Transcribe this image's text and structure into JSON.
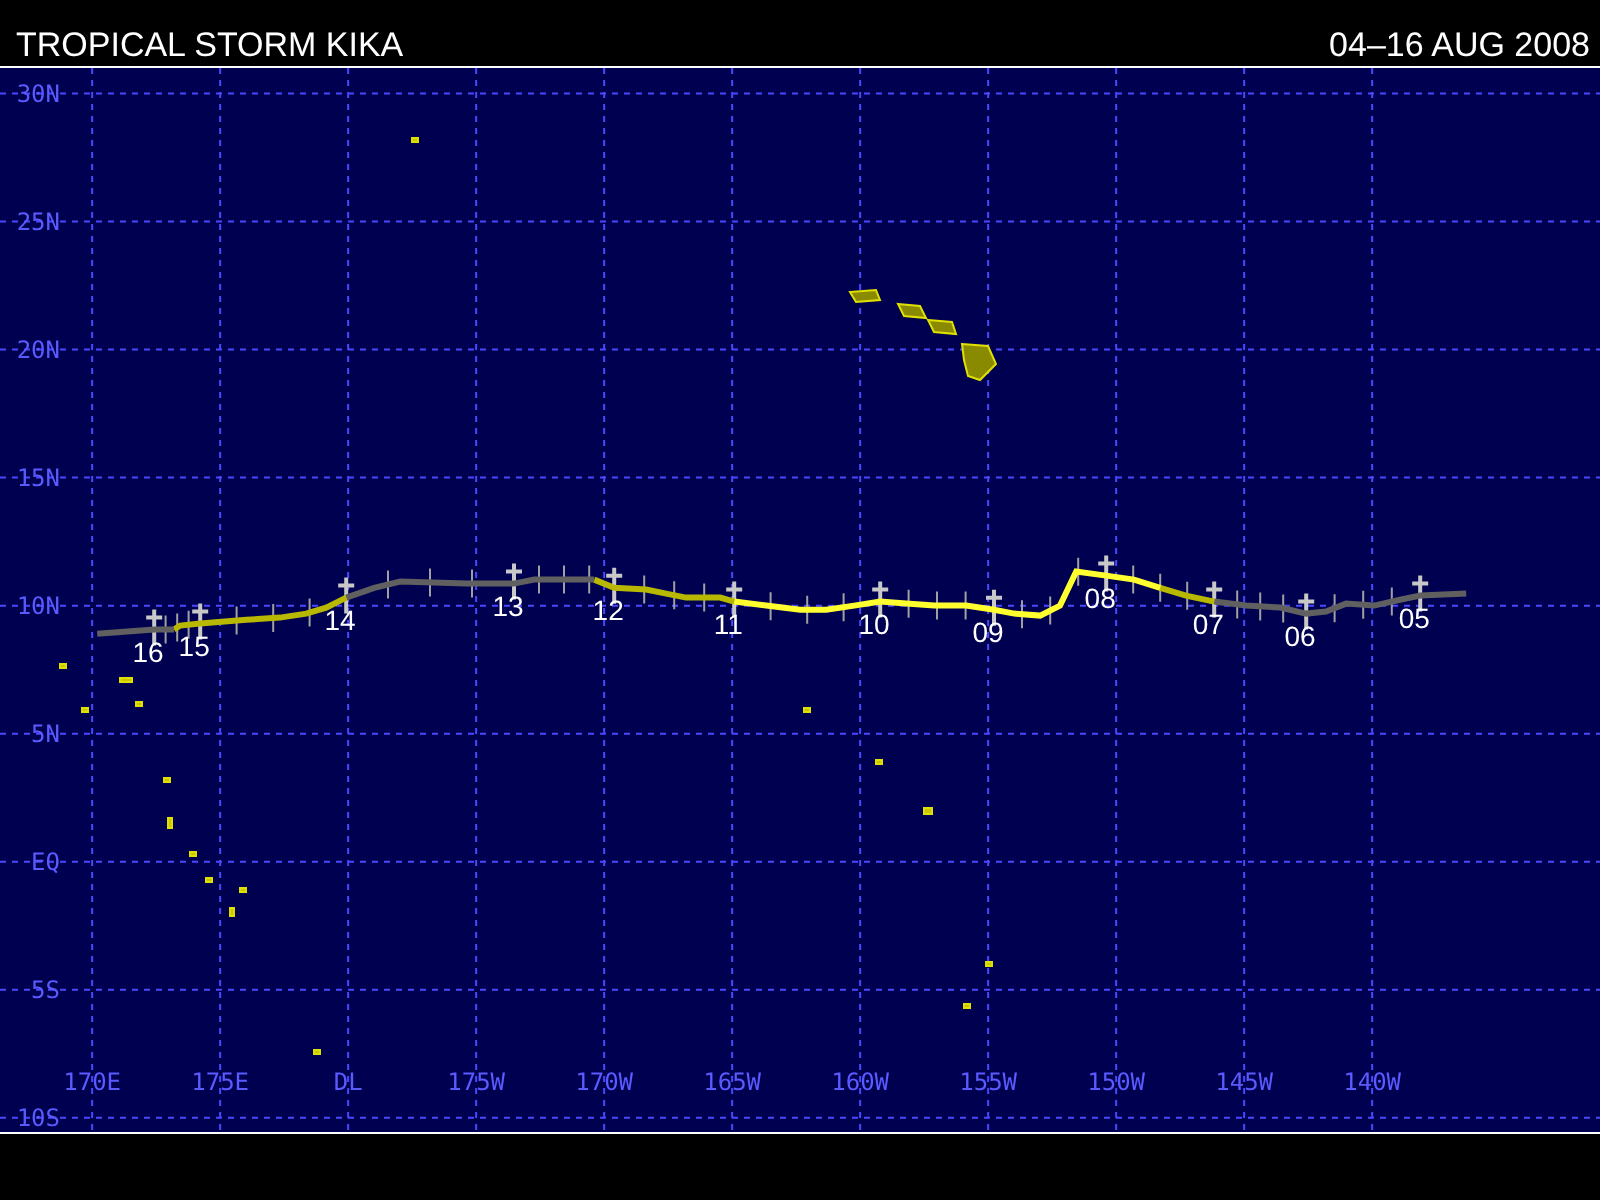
{
  "header": {
    "title": "TROPICAL STORM KIKA",
    "dates": "04–16 AUG 2008"
  },
  "map": {
    "latitude_labels": [
      "30N",
      "25N",
      "20N",
      "15N",
      "10N",
      "5N",
      "EQ",
      "5S",
      "10S"
    ],
    "longitude_labels": [
      "170E",
      "175E",
      "DL",
      "175W",
      "170W",
      "165W",
      "160W",
      "155W",
      "150W",
      "145W",
      "140W"
    ],
    "track_segments": [
      {
        "color": "#606060"
      },
      {
        "color": "#b8b800"
      },
      {
        "color": "#ffff30"
      },
      {
        "color": "#b8b800"
      },
      {
        "color": "#606060"
      },
      {
        "color": "#b8b800"
      },
      {
        "color": "#606060"
      }
    ],
    "day_labels": [
      "16",
      "15",
      "14",
      "13",
      "12",
      "11",
      "10",
      "09",
      "08",
      "07",
      "06",
      "05"
    ]
  }
}
